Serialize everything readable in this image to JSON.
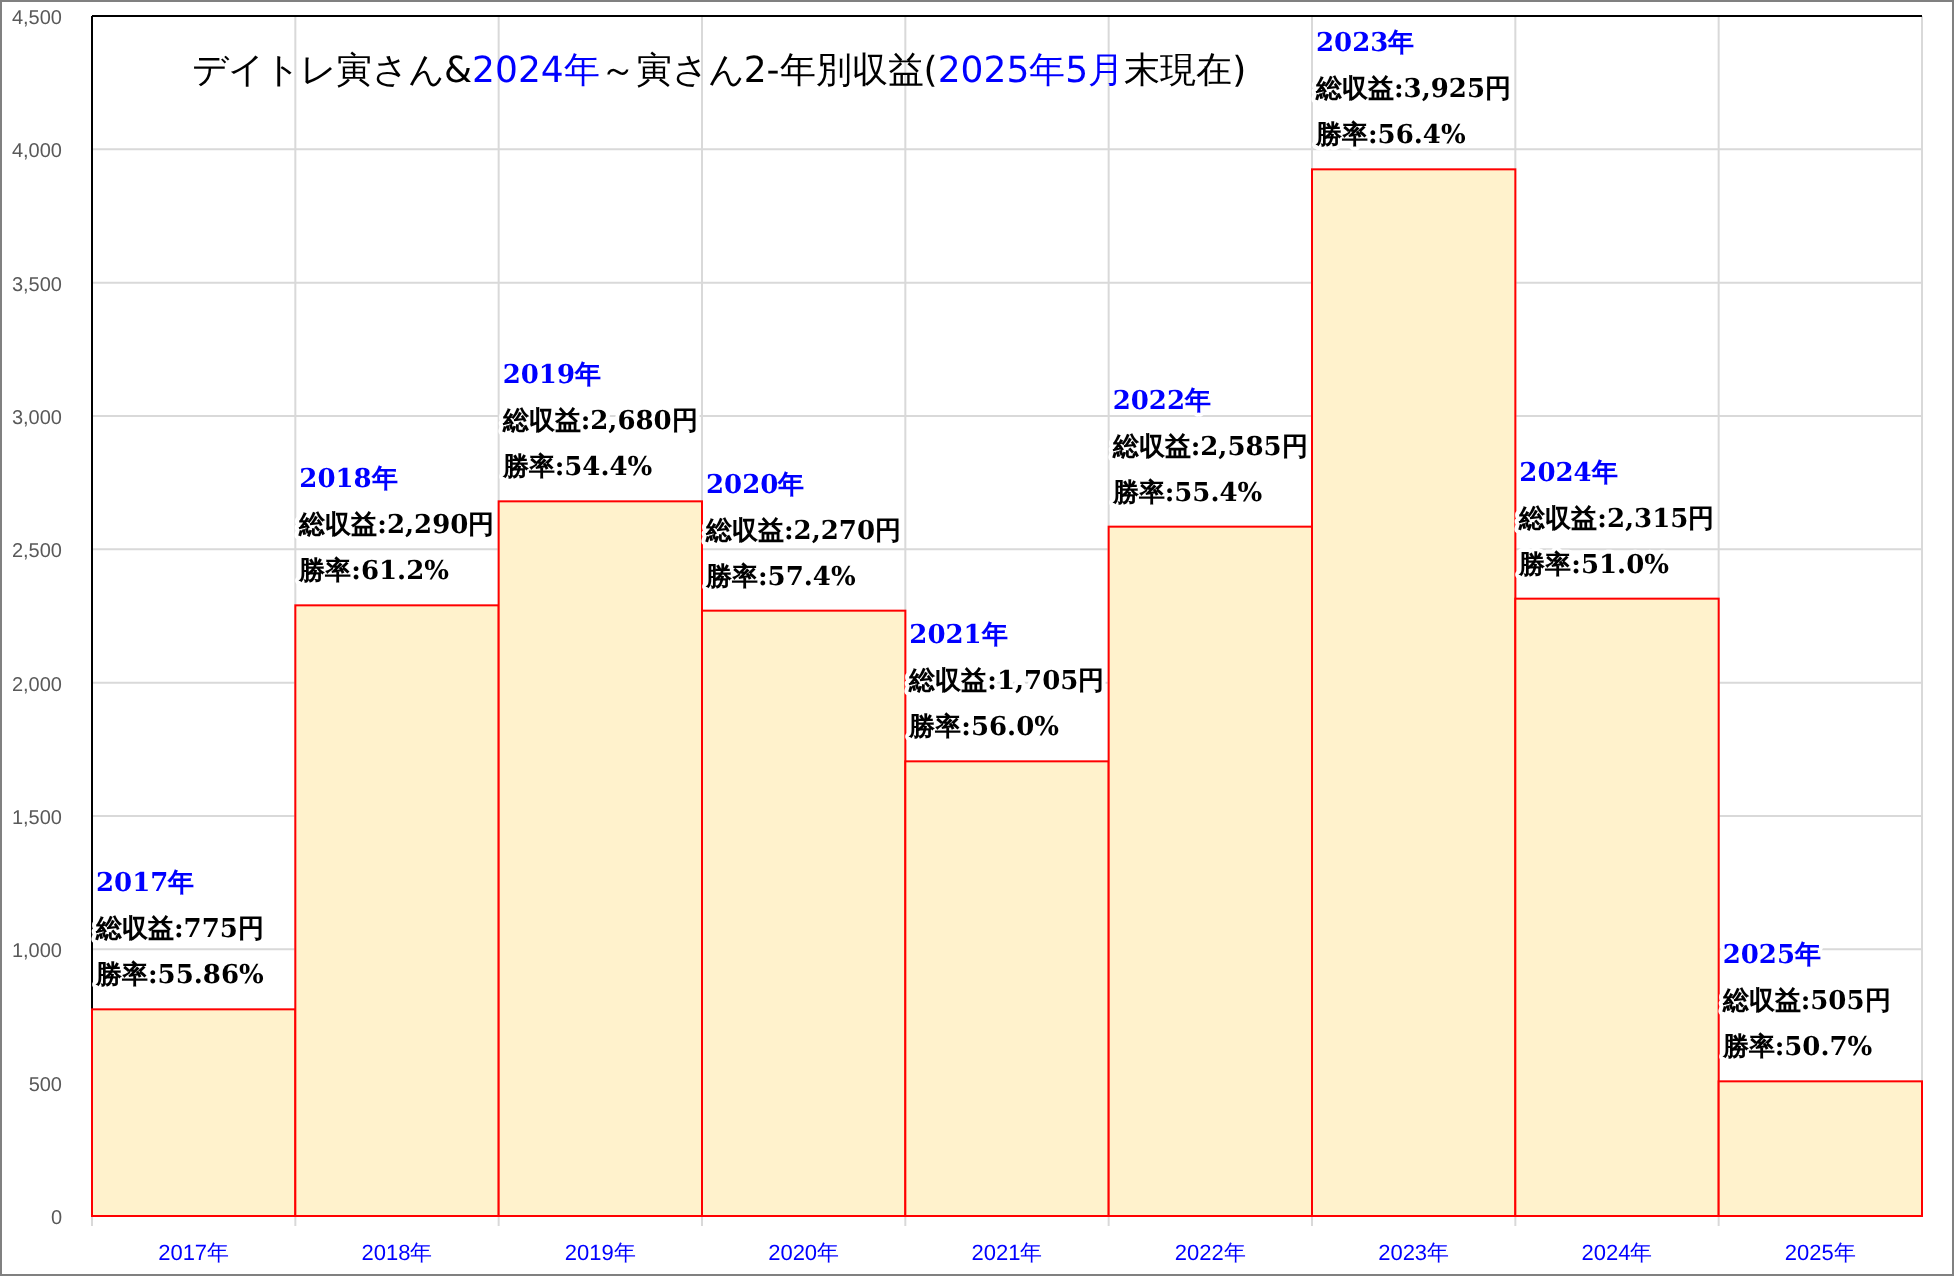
{
  "title_parts": [
    {
      "text": "デイトレ寅さん&",
      "color": "#000000"
    },
    {
      "text": "2024年",
      "color": "#0000ff"
    },
    {
      "text": "～寅さん2-年別収益(",
      "color": "#000000"
    },
    {
      "text": "2025年5月",
      "color": "#0000ff"
    },
    {
      "text": "末現在)",
      "color": "#000000"
    }
  ],
  "chart_data": {
    "type": "bar",
    "grid": true,
    "categories": [
      "2017年",
      "2018年",
      "2019年",
      "2020年",
      "2021年",
      "2022年",
      "2023年",
      "2024年",
      "2025年"
    ],
    "series": [
      {
        "color": "#fff2cc",
        "values": [
          775,
          2290,
          2680,
          2270,
          1705,
          2585,
          3925,
          2315,
          505
        ]
      }
    ],
    "ylim": [
      0,
      4500
    ],
    "yticks": [
      {
        "value": 0,
        "label": "0"
      },
      {
        "value": 500,
        "label": "500"
      },
      {
        "value": 1000,
        "label": "1,000"
      },
      {
        "value": 1500,
        "label": "1,500"
      },
      {
        "value": 2000,
        "label": "2,000"
      },
      {
        "value": 2500,
        "label": "2,500"
      },
      {
        "value": 3000,
        "label": "3,000"
      },
      {
        "value": 3500,
        "label": "3,500"
      },
      {
        "value": 4000,
        "label": "4,000"
      },
      {
        "value": 4500,
        "label": "4,500"
      }
    ],
    "annotations": [
      "2017年",
      "総収益:775円",
      "勝率:55.86%",
      "2018年",
      "総収益:2,290円",
      "勝率:61.2%",
      "2019年",
      "総収益:2,680円",
      "勝率:54.4%",
      "2020年",
      "総収益:2,270円",
      "勝率:57.4%",
      "2021年",
      "総収益:1,705円",
      "勝率:56.0%",
      "2022年",
      "総収益:2,585円",
      "勝率:55.4%",
      "2023年",
      "総収益:3,925円",
      "勝率:56.4%",
      "2024年",
      "総収益:2,315円",
      "勝率:51.0%",
      "2025年",
      "総収益:505円",
      "勝率:50.7%"
    ]
  }
}
